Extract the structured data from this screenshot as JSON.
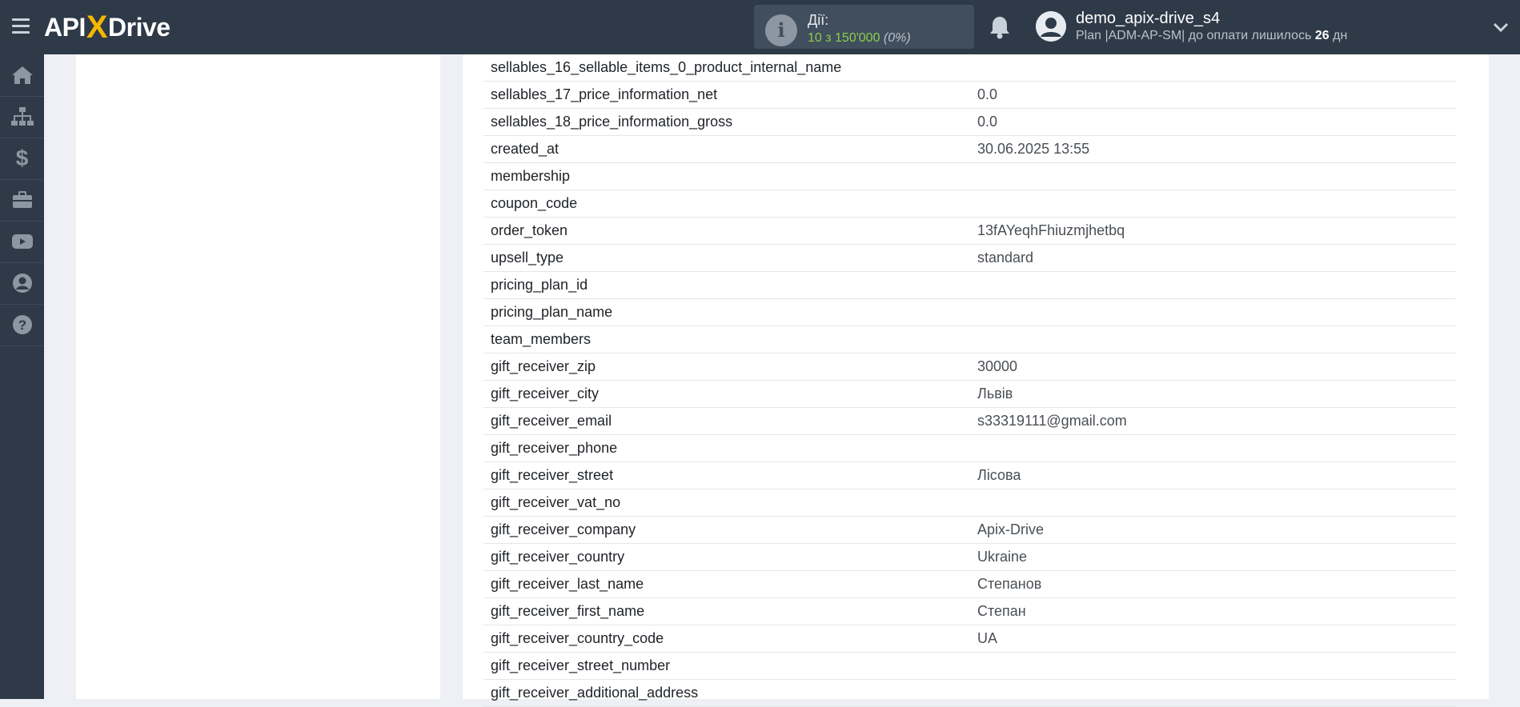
{
  "header": {
    "logo": {
      "part1": "API",
      "x": "X",
      "part2": "Drive"
    },
    "actions": {
      "title": "Дії:",
      "count": "10 з 150'000",
      "percent": "(0%)"
    },
    "user": {
      "name": "demo_apix-drive_s4",
      "plan_prefix": "Plan |ADM-AP-SM| до оплати лишилось ",
      "days": "26",
      "days_suffix": " дн"
    }
  },
  "sidebar": {
    "items": [
      {
        "icon": "home-icon"
      },
      {
        "icon": "sitemap-icon"
      },
      {
        "icon": "dollar-icon"
      },
      {
        "icon": "briefcase-icon"
      },
      {
        "icon": "youtube-icon"
      },
      {
        "icon": "user-circle-icon"
      },
      {
        "icon": "help-icon"
      }
    ]
  },
  "table": {
    "rows": [
      {
        "key": "sellables_16_sellable_items_0_product_internal_name",
        "value": ""
      },
      {
        "key": "sellables_17_price_information_net",
        "value": "0.0"
      },
      {
        "key": "sellables_18_price_information_gross",
        "value": "0.0"
      },
      {
        "key": "created_at",
        "value": "30.06.2025 13:55"
      },
      {
        "key": "membership",
        "value": ""
      },
      {
        "key": "coupon_code",
        "value": ""
      },
      {
        "key": "order_token",
        "value": "13fAYeqhFhiuzmjhetbq"
      },
      {
        "key": "upsell_type",
        "value": "standard"
      },
      {
        "key": "pricing_plan_id",
        "value": ""
      },
      {
        "key": "pricing_plan_name",
        "value": ""
      },
      {
        "key": "team_members",
        "value": ""
      },
      {
        "key": "gift_receiver_zip",
        "value": "30000"
      },
      {
        "key": "gift_receiver_city",
        "value": "Львів"
      },
      {
        "key": "gift_receiver_email",
        "value": "s33319111@gmail.com"
      },
      {
        "key": "gift_receiver_phone",
        "value": ""
      },
      {
        "key": "gift_receiver_street",
        "value": "Лісова"
      },
      {
        "key": "gift_receiver_vat_no",
        "value": ""
      },
      {
        "key": "gift_receiver_company",
        "value": "Apix-Drive"
      },
      {
        "key": "gift_receiver_country",
        "value": "Ukraine"
      },
      {
        "key": "gift_receiver_last_name",
        "value": "Степанов"
      },
      {
        "key": "gift_receiver_first_name",
        "value": "Степан"
      },
      {
        "key": "gift_receiver_country_code",
        "value": "UA"
      },
      {
        "key": "gift_receiver_street_number",
        "value": ""
      },
      {
        "key": "gift_receiver_additional_address",
        "value": ""
      }
    ]
  }
}
